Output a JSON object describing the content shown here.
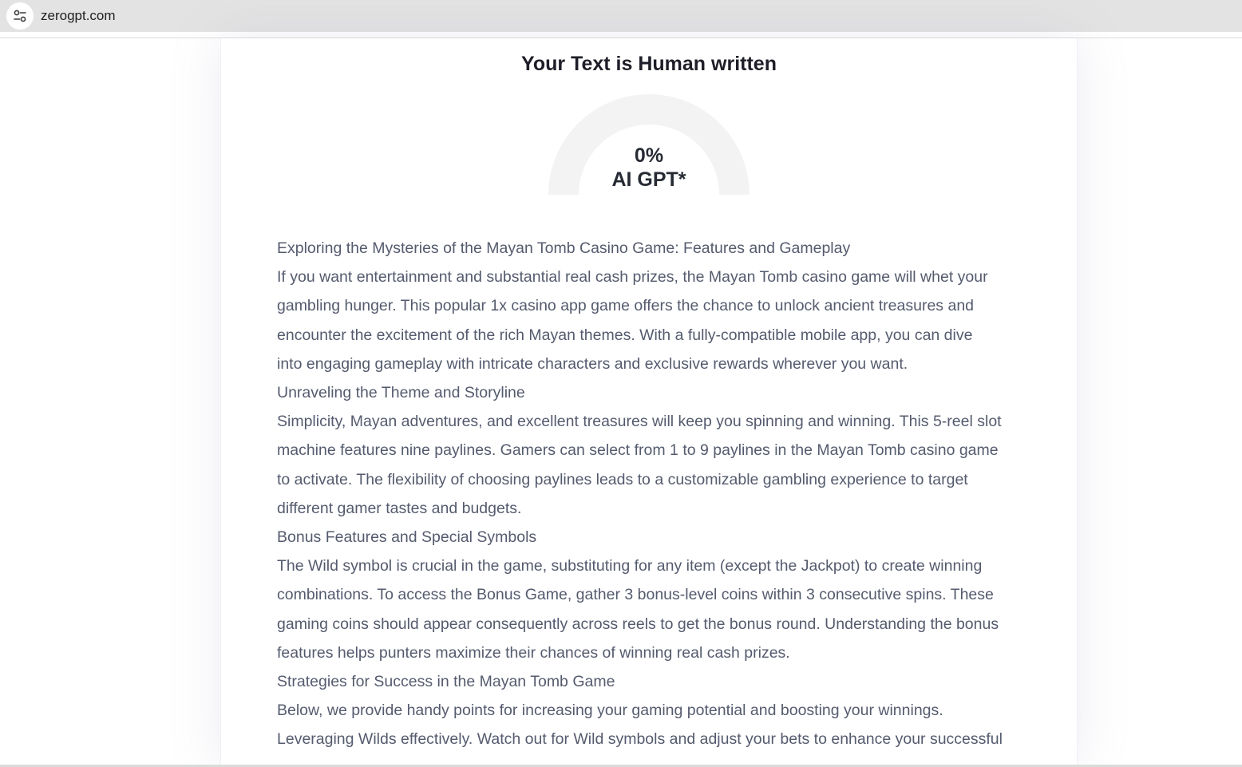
{
  "browser": {
    "url": "zerogpt.com",
    "site_info_icon": "tune-icon"
  },
  "result": {
    "title": "Your Text is Human written",
    "gauge": {
      "ai_fraction": 0,
      "value_text": "0%",
      "label_text": "AI GPT*",
      "track_color": "#f3f3f3",
      "fill_color": "#e23d3d"
    },
    "text_lines": [
      "Exploring the Mysteries of the Mayan Tomb Casino Game: Features and Gameplay",
      "If you want entertainment and substantial real cash prizes, the Mayan Tomb casino game will whet your",
      "gambling hunger. This popular 1x casino app game offers the chance to unlock ancient treasures and",
      "encounter the excitement of the rich Mayan themes. With a fully-compatible mobile app, you can dive",
      "into engaging gameplay with intricate characters and exclusive rewards wherever you want.",
      "Unraveling the Theme and Storyline",
      "Simplicity, Mayan adventures, and excellent treasures will keep you spinning and winning. This 5-reel slot",
      "machine features nine paylines. Gamers can select from 1 to 9 paylines in the Mayan Tomb casino game",
      "to activate. The flexibility of choosing paylines leads to a customizable gambling experience to target",
      "different gamer tastes and budgets.",
      "Bonus Features and Special Symbols",
      "The Wild symbol is crucial in the game, substituting for any item (except the Jackpot) to create winning",
      "combinations. To access the Bonus Game, gather 3 bonus-level coins within 3 consecutive spins. These",
      "gaming coins should appear consequently across reels to get the bonus round. Understanding the bonus",
      "features helps punters maximize their chances of winning real cash prizes.",
      "Strategies for Success in the Mayan Tomb Game",
      "Below, we provide handy points for increasing your gaming potential and boosting your winnings.",
      "Leveraging Wilds effectively. Watch out for Wild symbols and adjust your bets to enhance your successful"
    ]
  }
}
